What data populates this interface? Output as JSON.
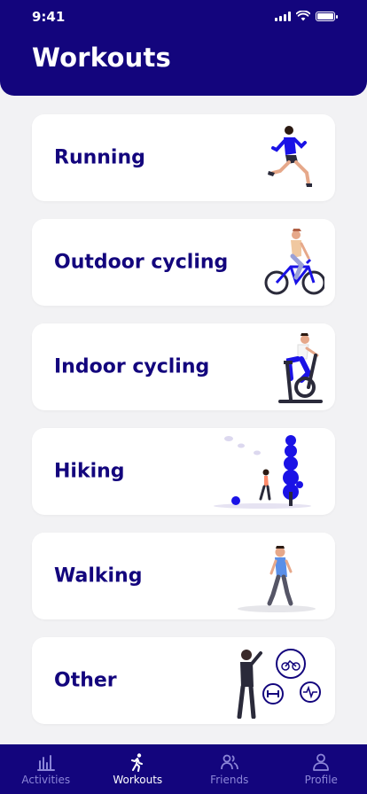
{
  "status_bar": {
    "time": "9:41"
  },
  "header": {
    "title": "Workouts"
  },
  "workouts": [
    {
      "label": "Running",
      "icon": "running-person-icon"
    },
    {
      "label": "Outdoor cycling",
      "icon": "outdoor-cyclist-icon"
    },
    {
      "label": "Indoor cycling",
      "icon": "indoor-bike-icon"
    },
    {
      "label": "Hiking",
      "icon": "hiker-icon"
    },
    {
      "label": "Walking",
      "icon": "walking-person-icon"
    },
    {
      "label": "Other",
      "icon": "other-activities-icon"
    }
  ],
  "tabbar": {
    "items": [
      {
        "label": "Activities",
        "icon": "bar-chart-icon",
        "active": false
      },
      {
        "label": "Workouts",
        "icon": "runner-icon",
        "active": true
      },
      {
        "label": "Friends",
        "icon": "friends-icon",
        "active": false
      },
      {
        "label": "Profile",
        "icon": "profile-icon",
        "active": false
      }
    ]
  },
  "colors": {
    "primary": "#13057d",
    "accent": "#1a12e6",
    "background": "#f2f2f4",
    "inactive_tab": "#8c86d8"
  }
}
